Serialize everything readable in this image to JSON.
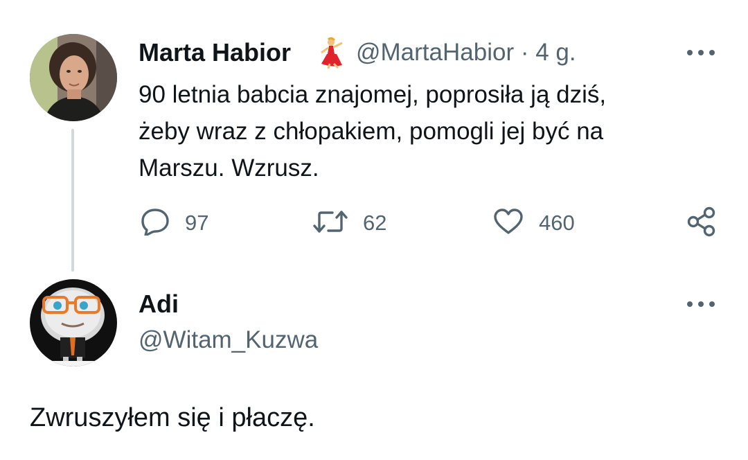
{
  "tweet": {
    "author_name": "Marta Habior",
    "author_emoji": "💃",
    "author_handle": "@MartaHabior",
    "separator": "·",
    "time": "4 g.",
    "text_lines": [
      "90 letnia babcia znajomej, poprosiła ją dziś,",
      "żeby wraz z chłopakiem, pomogli jej być na",
      "Marszu. Wzrusz."
    ],
    "replies": "97",
    "retweets": "62",
    "likes": "460"
  },
  "reply": {
    "author_name": "Adi",
    "author_handle": "@Witam_Kuzwa",
    "text": "Zwruszyłem się i płaczę."
  },
  "colors": {
    "text": "#0f1419",
    "secondary": "#536471",
    "thread_line": "#cfd9de"
  },
  "icons": {
    "more": "more-horizontal-icon",
    "reply": "speech-bubble-icon",
    "retweet": "retweet-icon",
    "like": "heart-icon",
    "share": "share-nodes-icon"
  }
}
